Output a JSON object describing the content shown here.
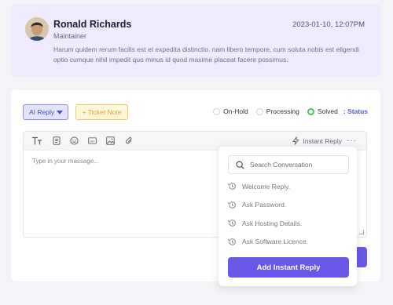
{
  "message": {
    "sender_name": "Ronald Richards",
    "sender_role": "Maintainer",
    "timestamp": "2023-01-10, 12:07PM",
    "body": "Harum quidem rerum facilis est et expedita distinctio. nam libero tempore, cum soluta nobis est eligendi optio cumque nihil impedit quo minus id quod maxime placeat facere possimus."
  },
  "reply": {
    "ai_reply_label": "AI Reply",
    "ticket_note_label": "+ Ticket Note",
    "statuses": [
      {
        "label": "On-Hold",
        "checked": false
      },
      {
        "label": "Processing",
        "checked": false
      },
      {
        "label": "Solved",
        "checked": true
      }
    ],
    "status_link": ": Status",
    "instant_reply_label": "Instant Reply",
    "editor_placeholder": "Type in your massage..."
  },
  "popover": {
    "search_placeholder": "Search Conversation",
    "items": [
      "Welcome Reply.",
      "Ask Password.",
      "Ask Hosting Details.",
      "Ask Software Licence."
    ],
    "add_button_label": "Add Instant Reply"
  },
  "colors": {
    "accent": "#6a58e8",
    "solved": "#4fc26a",
    "message_bg": "#efeafd",
    "ticket_note": "#e0a431"
  },
  "icons": [
    "text-size-icon",
    "document-icon",
    "emoji-icon",
    "gif-icon",
    "image-icon",
    "attachment-icon",
    "lightning-icon",
    "more-icon",
    "search-icon",
    "history-icon"
  ]
}
